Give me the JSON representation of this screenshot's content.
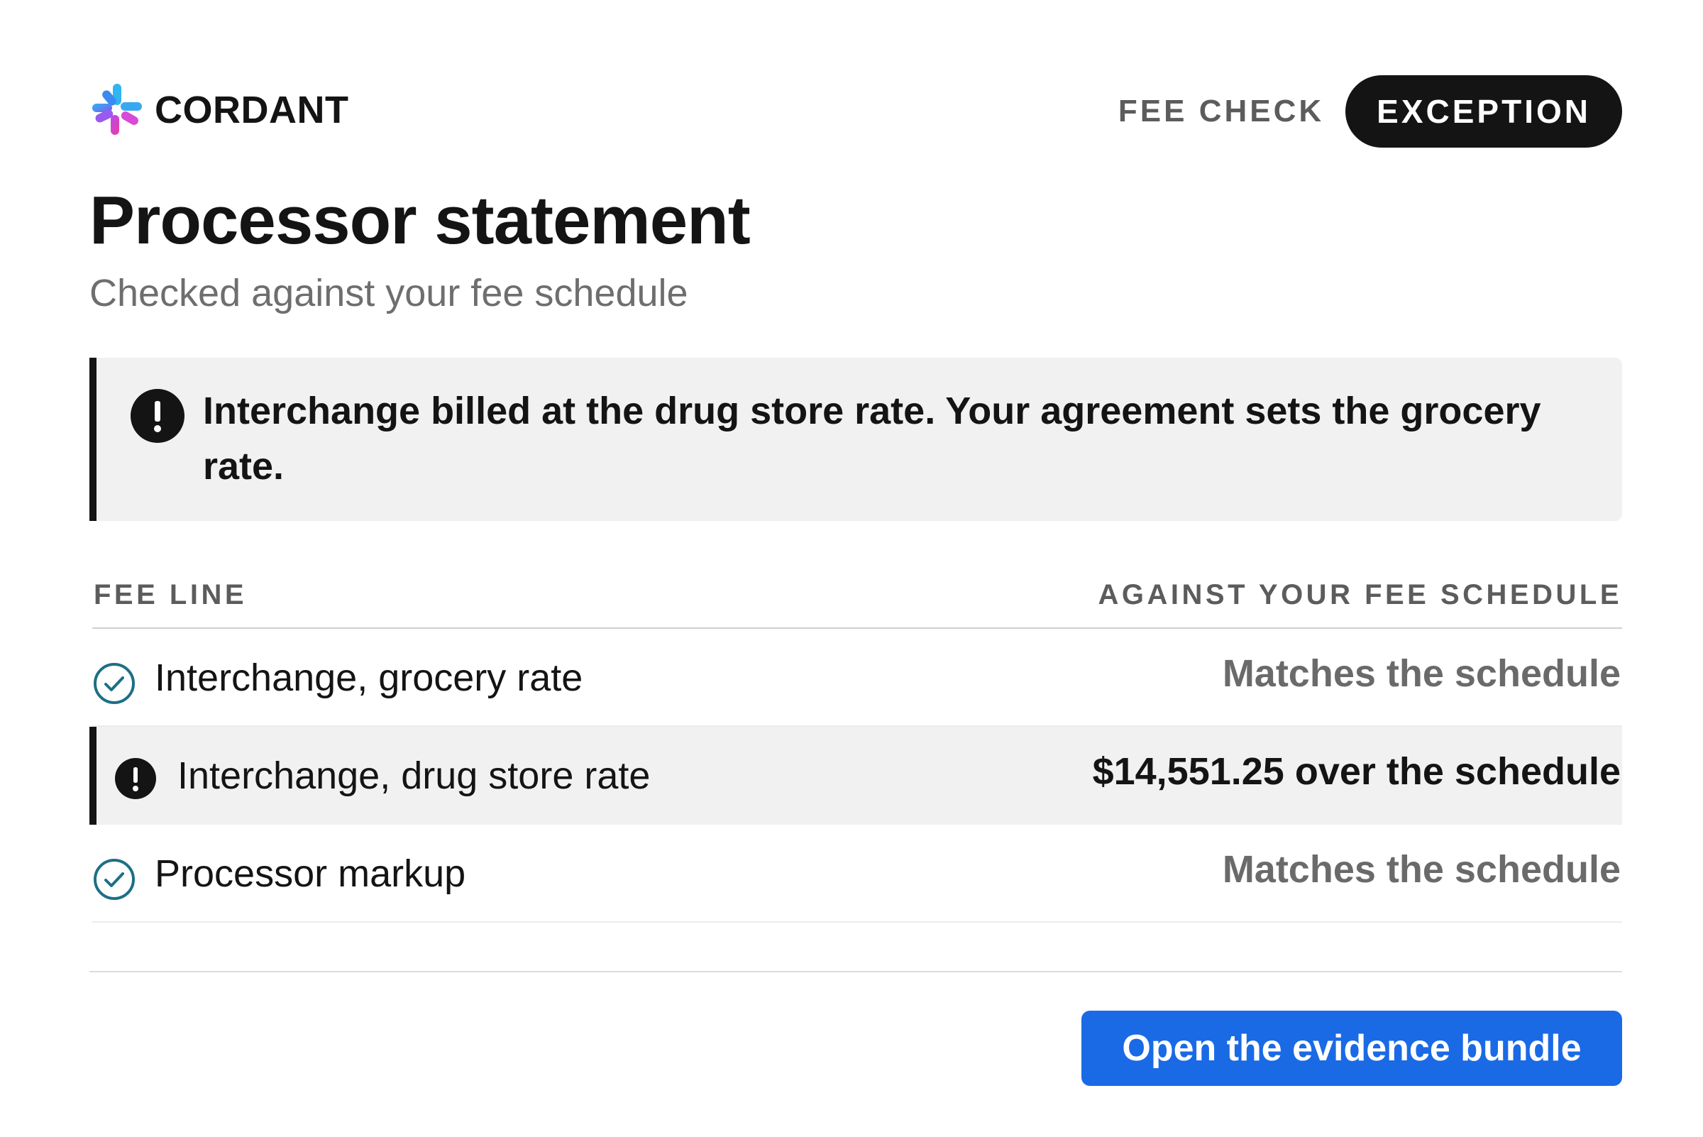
{
  "brand": {
    "name": "CORDANT",
    "logo_icon": "flower-logo-icon"
  },
  "status_tabs": {
    "fee_check": "FEE CHECK",
    "exception": "EXCEPTION"
  },
  "header": {
    "title": "Processor statement",
    "subtitle": "Checked against your fee schedule"
  },
  "alert": {
    "icon": "exclamation-circle-icon",
    "text": "Interchange billed at the drug store rate. Your agreement sets the grocery rate."
  },
  "table": {
    "columns": [
      "FEE LINE",
      "AGAINST YOUR FEE SCHEDULE"
    ],
    "rows": [
      {
        "label": "Interchange, grocery rate",
        "result": "Matches the schedule",
        "status": "ok",
        "icon": "check-circle-icon"
      },
      {
        "label": "Interchange, drug store rate",
        "result": "$14,551.25 over the schedule",
        "status": "exception",
        "icon": "exclamation-circle-icon"
      },
      {
        "label": "Processor markup",
        "result": "Matches the schedule",
        "status": "ok",
        "icon": "check-circle-icon"
      }
    ]
  },
  "cta": {
    "label": "Open the evidence bundle"
  },
  "colors": {
    "accent_blue": "#1a6ae6",
    "check_teal": "#1d6f86",
    "ink": "#141414",
    "muted": "#6a6a6a",
    "alert_bg": "#f1f1f1"
  }
}
